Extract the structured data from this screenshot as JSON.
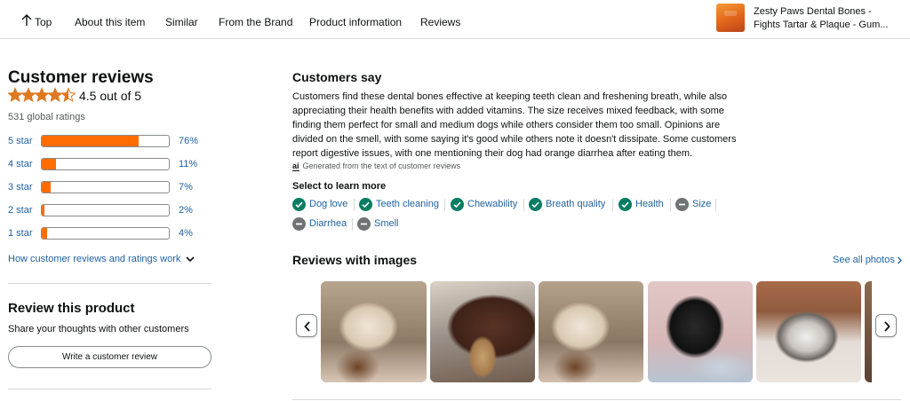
{
  "nav": {
    "items": [
      "Top",
      "About this item",
      "Similar",
      "From the Brand",
      "Product information",
      "Reviews"
    ],
    "product_title_line1": "Zesty Paws Dental Bones -",
    "product_title_line2": "Fights Tartar & Plaque - Gum..."
  },
  "reviews": {
    "title": "Customer reviews",
    "rating": 4.5,
    "rating_text": "4.5 out of 5",
    "global_ratings": "531 global ratings",
    "histogram": [
      {
        "label": "5 star",
        "pct_text": "76%",
        "percent": 76
      },
      {
        "label": "4 star",
        "pct_text": "11%",
        "percent": 11
      },
      {
        "label": "3 star",
        "pct_text": "7%",
        "percent": 7
      },
      {
        "label": "2 star",
        "pct_text": "2%",
        "percent": 2
      },
      {
        "label": "1 star",
        "pct_text": "4%",
        "percent": 4
      }
    ],
    "how_link": "How customer reviews and ratings work"
  },
  "review_product": {
    "title": "Review this product",
    "subtitle": "Share your thoughts with other customers",
    "button": "Write a customer review"
  },
  "customers_say": {
    "title": "Customers say",
    "summary": "Customers find these dental bones effective at keeping teeth clean and freshening breath, while also appreciating their health benefits with added vitamins. The size receives mixed feedback, with some finding them perfect for small and medium dogs while others consider them too small. Opinions are divided on the smell, with some saying it's good while others note it doesn't dissipate. Some customers report digestive issues, with one mentioning their dog had orange diarrhea after eating them.",
    "ai_badge": "ai",
    "ai_note": "Generated from the text of customer reviews",
    "select_title": "Select to learn more",
    "aspects": [
      {
        "label": "Dog love",
        "sentiment": "positive"
      },
      {
        "label": "Teeth cleaning",
        "sentiment": "positive"
      },
      {
        "label": "Chewability",
        "sentiment": "positive"
      },
      {
        "label": "Breath quality",
        "sentiment": "positive"
      },
      {
        "label": "Health",
        "sentiment": "positive"
      },
      {
        "label": "Size",
        "sentiment": "mixed"
      },
      {
        "label": "Diarrhea",
        "sentiment": "mixed"
      },
      {
        "label": "Smell",
        "sentiment": "mixed"
      }
    ]
  },
  "images_section": {
    "title": "Reviews with images",
    "see_all": "See all photos"
  },
  "colors": {
    "star": "#de7921",
    "bar_fill": "#ff6d00",
    "link": "#2162a1",
    "positive": "#067d62",
    "mixed": "#6f7373"
  }
}
